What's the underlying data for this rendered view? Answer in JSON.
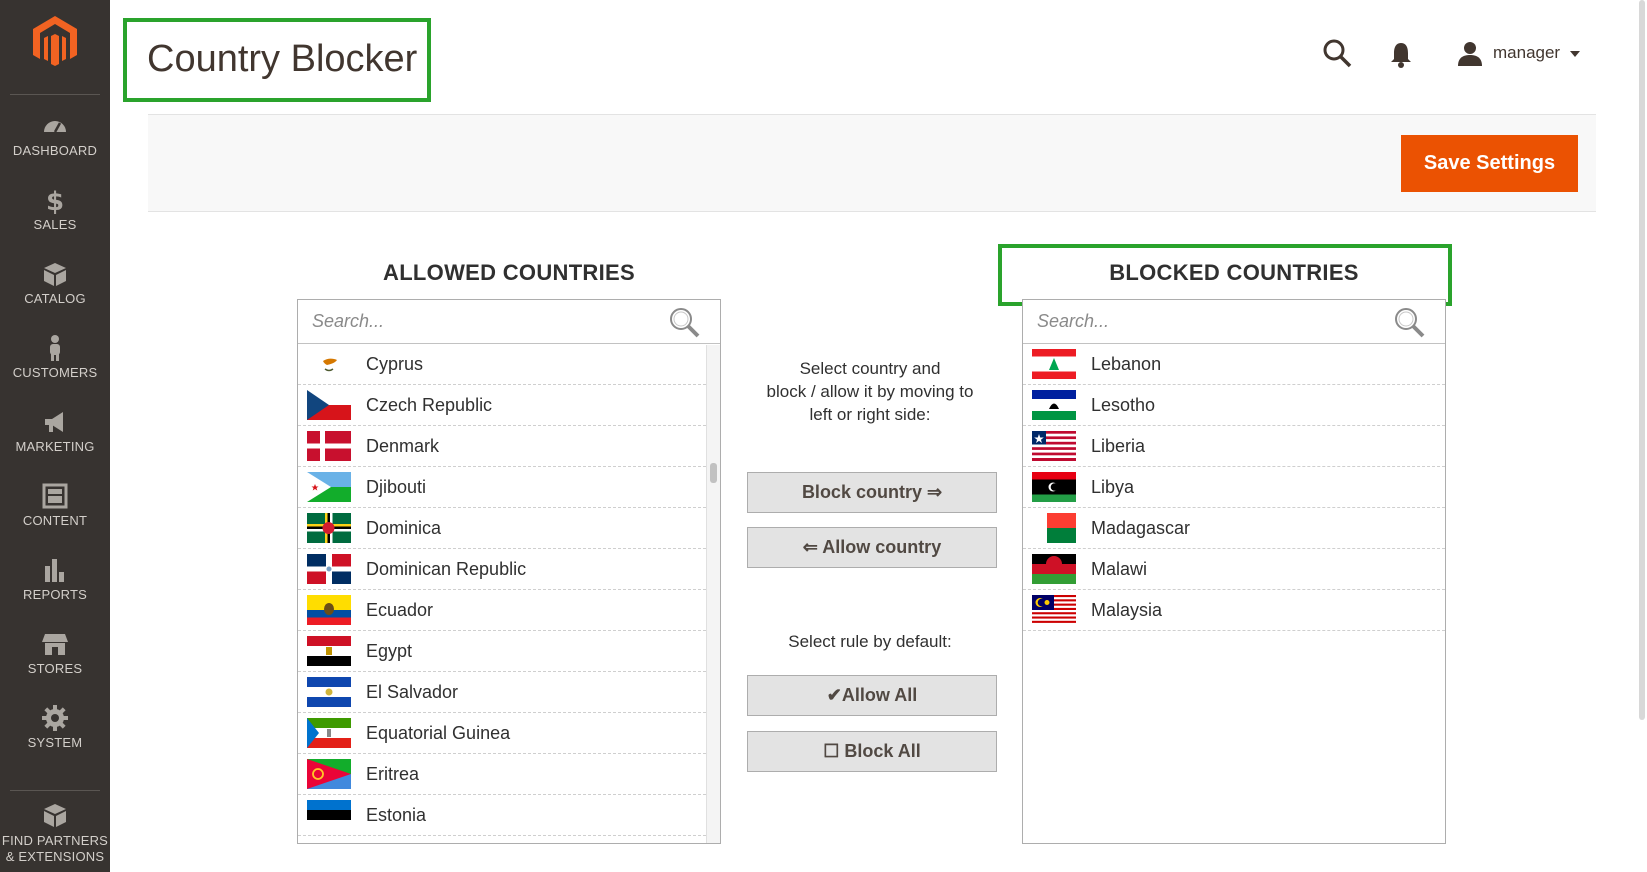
{
  "sidebar": {
    "items": [
      {
        "label": "DASHBOARD",
        "icon": "dashboard-icon"
      },
      {
        "label": "SALES",
        "icon": "dollar-icon"
      },
      {
        "label": "CATALOG",
        "icon": "box-icon"
      },
      {
        "label": "CUSTOMERS",
        "icon": "person-icon"
      },
      {
        "label": "MARKETING",
        "icon": "megaphone-icon"
      },
      {
        "label": "CONTENT",
        "icon": "layout-icon"
      },
      {
        "label": "REPORTS",
        "icon": "bar-chart-icon"
      },
      {
        "label": "STORES",
        "icon": "storefront-icon"
      },
      {
        "label": "SYSTEM",
        "icon": "gear-icon"
      },
      {
        "label_line1": "FIND PARTNERS",
        "label_line2": "& EXTENSIONS",
        "icon": "extensions-icon"
      }
    ]
  },
  "header": {
    "title": "Country Blocker",
    "user_name": "manager"
  },
  "actions": {
    "save_label": "Save Settings"
  },
  "colors": {
    "accent": "#eb5202",
    "highlight_border": "#2aa32c",
    "sidebar_bg": "#373330"
  },
  "allowed": {
    "heading": "ALLOWED COUNTRIES",
    "search_placeholder": "Search...",
    "countries": [
      {
        "name": "Cyprus"
      },
      {
        "name": "Czech Republic"
      },
      {
        "name": "Denmark"
      },
      {
        "name": "Djibouti"
      },
      {
        "name": "Dominica"
      },
      {
        "name": "Dominican Republic"
      },
      {
        "name": "Ecuador"
      },
      {
        "name": "Egypt"
      },
      {
        "name": "El Salvador"
      },
      {
        "name": "Equatorial Guinea"
      },
      {
        "name": "Eritrea"
      },
      {
        "name": "Estonia"
      }
    ]
  },
  "blocked": {
    "heading": "BLOCKED COUNTRIES",
    "search_placeholder": "Search...",
    "countries": [
      {
        "name": "Lebanon"
      },
      {
        "name": "Lesotho"
      },
      {
        "name": "Liberia"
      },
      {
        "name": "Libya"
      },
      {
        "name": "Madagascar"
      },
      {
        "name": "Malawi"
      },
      {
        "name": "Malaysia"
      }
    ]
  },
  "middle": {
    "instructions_line1": "Select country and",
    "instructions_line2": "block / allow it by moving to",
    "instructions_line3": "left or right side:",
    "block_country_label": "Block country ⇒",
    "allow_country_label": "⇐ Allow country",
    "default_rule_label": "Select rule by default:",
    "allow_all_label": "✔Allow All",
    "block_all_label": "☐ Block All"
  }
}
